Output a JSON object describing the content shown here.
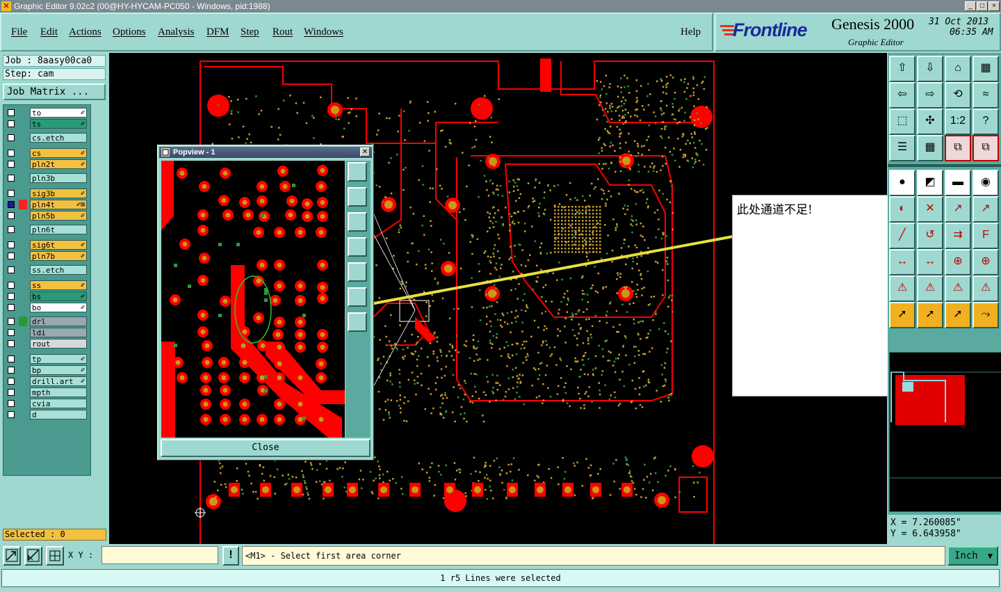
{
  "window": {
    "title": "Graphic Editor 9.02c2 (00@HY-HYCAM-PC050 - Windows, pid:1988)",
    "minimize": "_",
    "maximize": "□",
    "close": "×"
  },
  "menu": {
    "items": [
      "File",
      "Edit",
      "Actions",
      "Options",
      "Analysis",
      "DFM",
      "Step",
      "Rout",
      "Windows"
    ],
    "help": "Help"
  },
  "branding": {
    "logo": "Frontline",
    "product": "Genesis 2000",
    "subtitle": "Graphic Editor",
    "date": "31 Oct 2013",
    "time": "06:35 AM"
  },
  "job": {
    "job_label": "Job : 8aasy00ca0",
    "step_label": "Step: cam",
    "matrix_button": "Job Matrix ..."
  },
  "layers": [
    {
      "name": "to",
      "color": "#ffffff",
      "mark": "✐"
    },
    {
      "name": "ts",
      "color": "#2a9a78",
      "mark": "✐"
    },
    {
      "name": "cs.etch",
      "color": "#a8e0d8",
      "mark": ""
    },
    {
      "name": "cs",
      "color": "#f4c040",
      "mark": "✐"
    },
    {
      "name": "pln2t",
      "color": "#f4c040",
      "mark": "✐"
    },
    {
      "name": "pln3b",
      "color": "#a8e0d8",
      "mark": ""
    },
    {
      "name": "sig3b",
      "color": "#f4c040",
      "mark": "✐"
    },
    {
      "name": "pln4t",
      "color": "#f4c040",
      "mark": "✐⊞",
      "active": true
    },
    {
      "name": "pln5b",
      "color": "#f4c040",
      "mark": "✐"
    },
    {
      "name": "pln6t",
      "color": "#a8e0d8",
      "mark": ""
    },
    {
      "name": "sig6t",
      "color": "#f4c040",
      "mark": "✐"
    },
    {
      "name": "pln7b",
      "color": "#f4c040",
      "mark": "✐"
    },
    {
      "name": "ss.etch",
      "color": "#a8e0d8",
      "mark": ""
    },
    {
      "name": "ss",
      "color": "#f4c040",
      "mark": "✐"
    },
    {
      "name": "bs",
      "color": "#2a9a78",
      "mark": "✐"
    },
    {
      "name": "bo",
      "color": "#ffffff",
      "mark": "✐"
    },
    {
      "name": "drl",
      "color": "#9aa8b0",
      "mark": ""
    },
    {
      "name": "ldi",
      "color": "#9aa8b0",
      "mark": ""
    },
    {
      "name": "rout",
      "color": "#d8d8d8",
      "mark": ""
    },
    {
      "name": "tp",
      "color": "#a8e0d8",
      "mark": "✐"
    },
    {
      "name": "bp",
      "color": "#a8e0d8",
      "mark": "✐"
    },
    {
      "name": "drill.art",
      "color": "#a8e0d8",
      "mark": "✐"
    },
    {
      "name": "mpth",
      "color": "#a8e0d8",
      "mark": ""
    },
    {
      "name": "cvia",
      "color": "#a8e0d8",
      "mark": ""
    },
    {
      "name": "d",
      "color": "#a8e0d8",
      "mark": ""
    }
  ],
  "selected": "Selected : 0",
  "popview": {
    "title": "Popview - 1",
    "close_button": "Close"
  },
  "annotation": {
    "text": "此处通道不足!"
  },
  "coords": {
    "x": "X = 7.260085\"",
    "y": "Y = 6.643958\""
  },
  "bottom": {
    "xy_label": "X Y :",
    "xy_value": "",
    "alert_icon": "!",
    "prompt": "<M1> - Select first area corner",
    "units": "Inch",
    "status": "1 r5 Lines were selected"
  },
  "colors": {
    "panel": "#9ed8d0",
    "trace": "#ff0000",
    "pad_core": "#c89818",
    "drill": "#2a9a40",
    "annotation_line": "#e8e040"
  }
}
